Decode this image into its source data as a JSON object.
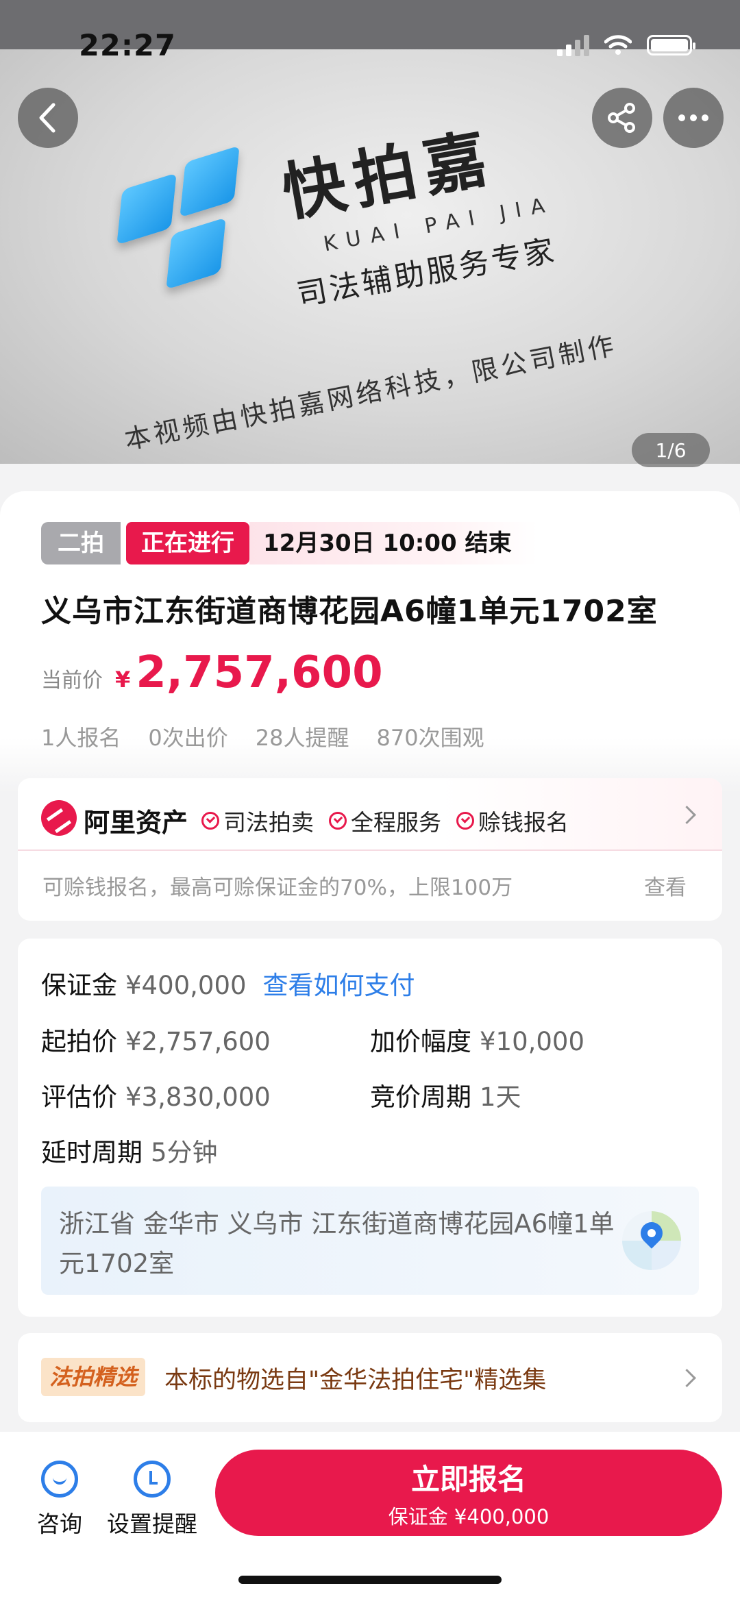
{
  "status_bar": {
    "time": "22:27"
  },
  "hero": {
    "brand": "快拍嘉",
    "pinyin": "KUAI PAI JIA",
    "slogan": "司法辅助服务专家",
    "credit": "本视频由快拍嘉网络科技，限公司制作",
    "page_indicator": "1/6",
    "icons": {
      "back": "back-arrow-icon",
      "share": "share-icon",
      "more": "more-icon"
    }
  },
  "auction": {
    "round_tag": "二拍",
    "status_tag": "正在进行",
    "end_time": "12月30日 10:00 结束",
    "title": "义乌市江东街道商博花园A6幢1单元1702室",
    "price_label": "当前价",
    "currency": "¥",
    "current_price": "2,757,600",
    "stats": [
      "1人报名",
      "0次出价",
      "28人提醒",
      "870次围观"
    ]
  },
  "ali": {
    "brand": "阿里资产",
    "badges": [
      "司法拍卖",
      "全程服务",
      "赊钱报名"
    ],
    "desc": "可赊钱报名，最高可赊保证金的70%，上限100万",
    "view": "查看"
  },
  "info": {
    "deposit_label": "保证金",
    "deposit_value": "¥400,000",
    "deposit_link": "查看如何支付",
    "start_label": "起拍价",
    "start_value": "¥2,757,600",
    "increment_label": "加价幅度",
    "increment_value": "¥10,000",
    "appraisal_label": "评估价",
    "appraisal_value": "¥3,830,000",
    "cycle_label": "竞价周期",
    "cycle_value": "1天",
    "delay_label": "延时周期",
    "delay_value": "5分钟",
    "address": "浙江省 金华市 义乌市 江东街道商博花园A6幢1单元1702室"
  },
  "featured": {
    "tag": "法拍精选",
    "text": "本标的物选自\"金华法拍住宅\"精选集"
  },
  "bottom_bar": {
    "consult_label": "咨询",
    "remind_label": "设置提醒",
    "cta_label": "立即报名",
    "cta_sub": "保证金 ¥400,000"
  },
  "colors": {
    "accent": "#e8194c",
    "link": "#2d7ee8"
  }
}
